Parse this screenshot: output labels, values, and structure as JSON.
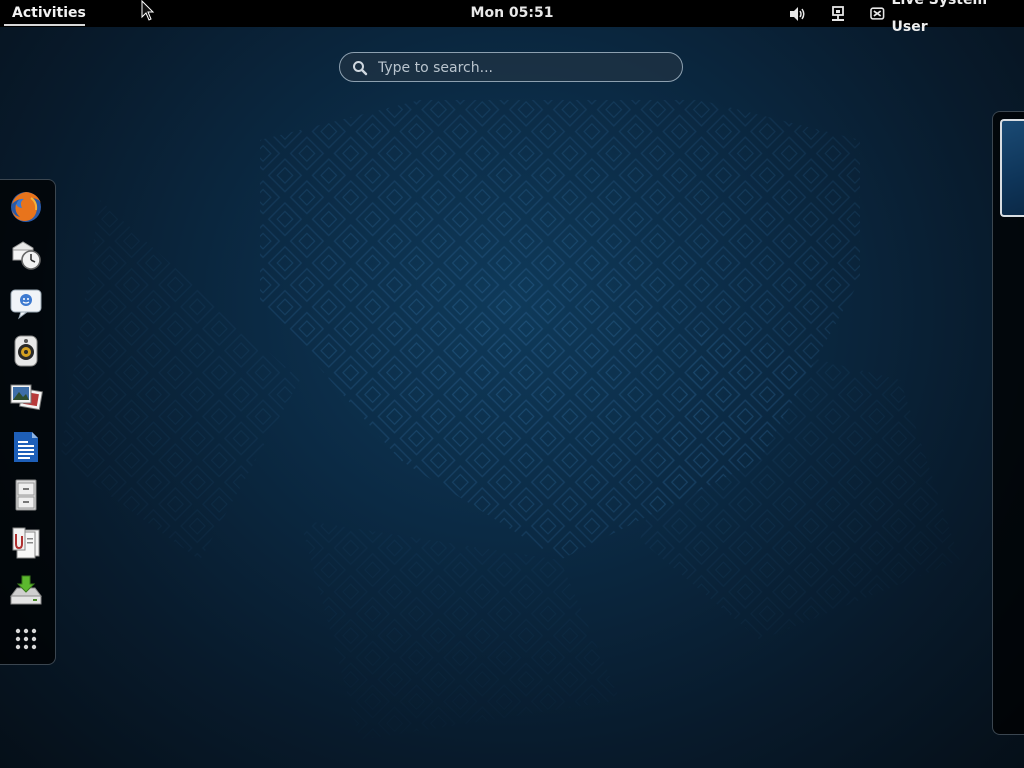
{
  "topbar": {
    "activities_label": "Activities",
    "clock": "Mon 05:51",
    "user_name": "Live System User",
    "tray_icons": [
      "volume-icon",
      "network-wired-icon",
      "user-status-icon"
    ]
  },
  "search": {
    "placeholder": "Type to search..."
  },
  "dash": {
    "items": [
      {
        "name": "firefox",
        "icon": "firefox-icon"
      },
      {
        "name": "evolution",
        "icon": "mail-clock-icon"
      },
      {
        "name": "empathy",
        "icon": "chat-icon"
      },
      {
        "name": "rhythmbox",
        "icon": "speaker-icon"
      },
      {
        "name": "shotwell",
        "icon": "photos-icon"
      },
      {
        "name": "writer",
        "icon": "document-icon"
      },
      {
        "name": "files",
        "icon": "file-cabinet-icon"
      },
      {
        "name": "documents",
        "icon": "documents-icon"
      },
      {
        "name": "install",
        "icon": "install-to-disk-icon"
      },
      {
        "name": "show-applications",
        "icon": "app-grid-icon"
      }
    ]
  },
  "colors": {
    "topbar_bg": "#000000",
    "wallpaper": "#0b2a44",
    "accent": "#d8dde2"
  }
}
